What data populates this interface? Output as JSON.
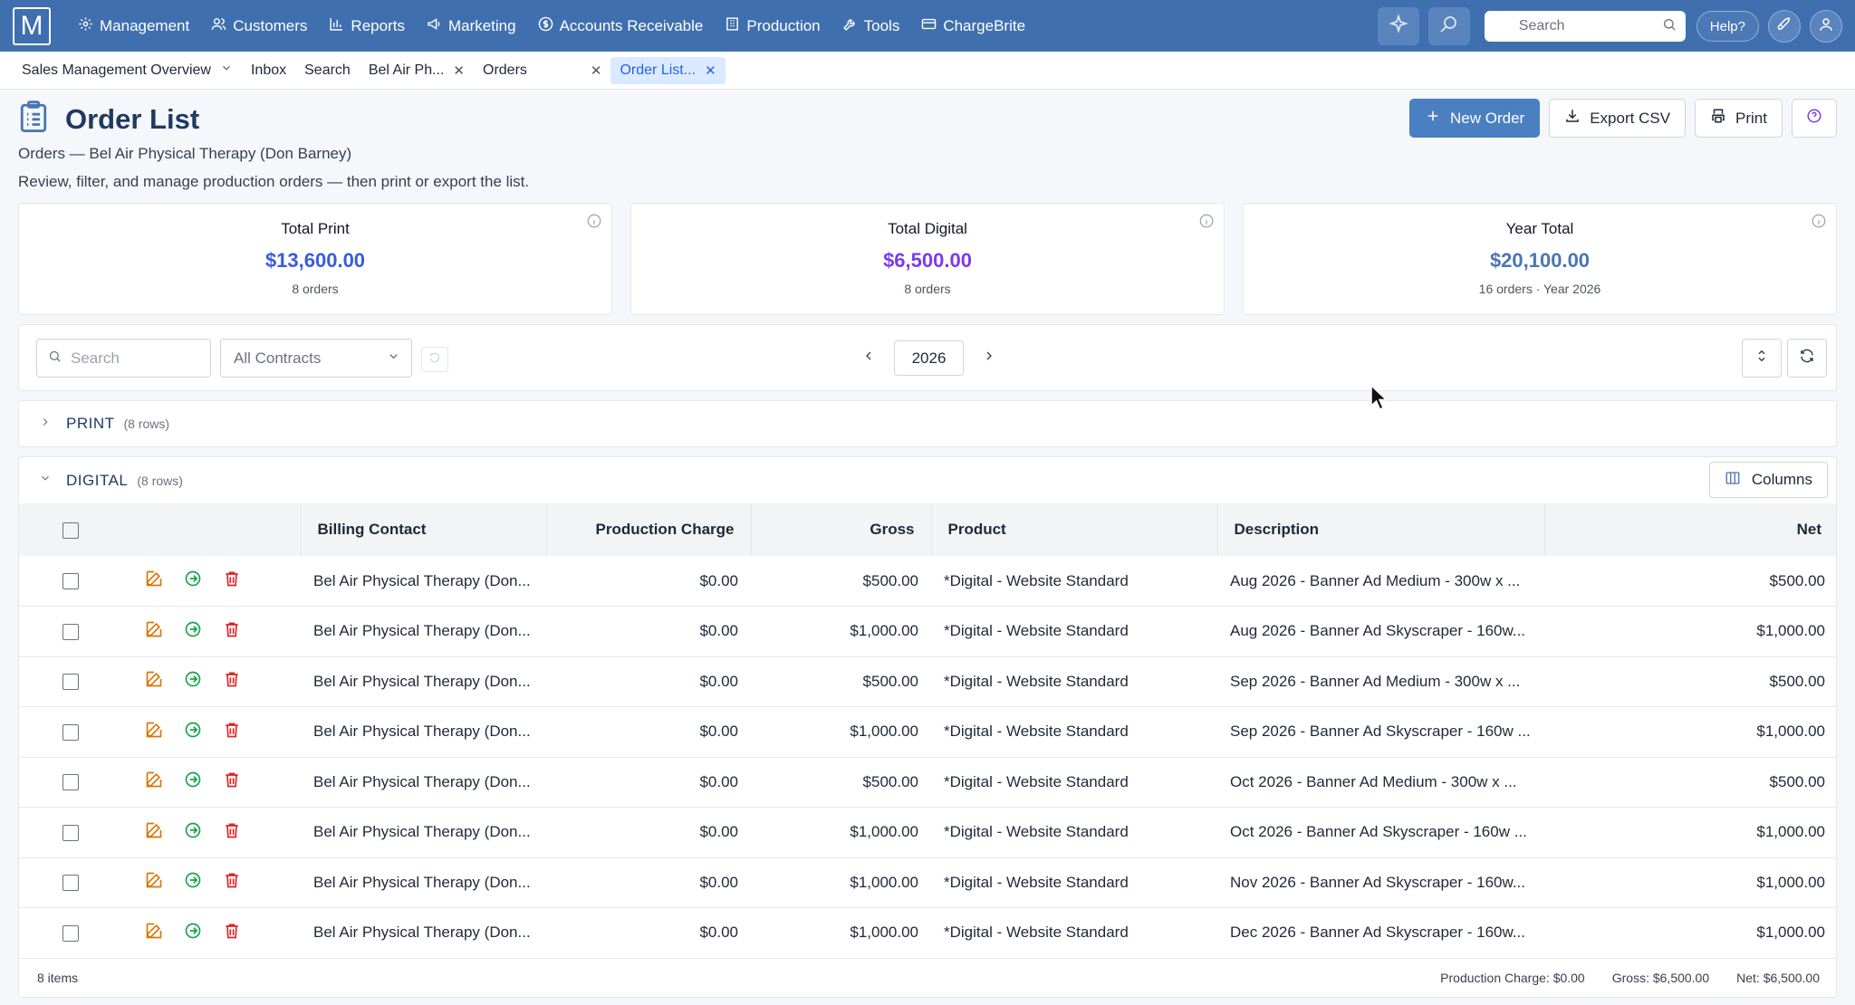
{
  "app": {
    "logo": "M",
    "nav": [
      {
        "label": "Management",
        "icon": "gear-icon"
      },
      {
        "label": "Customers",
        "icon": "users-icon"
      },
      {
        "label": "Reports",
        "icon": "bar-chart-icon"
      },
      {
        "label": "Marketing",
        "icon": "megaphone-icon"
      },
      {
        "label": "Accounts Receivable",
        "icon": "dollar-circle-icon"
      },
      {
        "label": "Production",
        "icon": "building-icon"
      },
      {
        "label": "Tools",
        "icon": "wrench-icon"
      },
      {
        "label": "ChargeBrite",
        "icon": "credit-card-icon"
      }
    ],
    "search_placeholder": "Search",
    "help_label": "Help?"
  },
  "tabs": [
    {
      "label": "Sales Management Overview",
      "has_dropdown": true
    },
    {
      "label": "Inbox"
    },
    {
      "label": "Search"
    },
    {
      "label": "Bel Air Ph...",
      "closable": true
    },
    {
      "label": "Orders",
      "closable": true
    },
    {
      "label": "Order List...",
      "closable": true,
      "active": true
    }
  ],
  "page": {
    "title": "Order List",
    "subtitle": "Orders — Bel Air Physical Therapy (Don Barney)",
    "description": "Review, filter, and manage production orders — then print or export the list.",
    "actions": {
      "new_order": "New Order",
      "export_csv": "Export CSV",
      "print": "Print"
    }
  },
  "cards": [
    {
      "title": "Total Print",
      "value": "$13,600.00",
      "sub": "8 orders",
      "color": "#3b5bdb"
    },
    {
      "title": "Total Digital",
      "value": "$6,500.00",
      "sub": "8 orders",
      "color": "#7c3aed"
    },
    {
      "title": "Year Total",
      "value": "$20,100.00",
      "sub": "16 orders · Year 2026",
      "color": "#4a76b3"
    }
  ],
  "filters": {
    "search_placeholder": "Search",
    "contract": "All Contracts",
    "year": "2026"
  },
  "groups": {
    "print": {
      "label": "PRINT",
      "count": "(8 rows)"
    },
    "digital": {
      "label": "DIGITAL",
      "count": "(8 rows)",
      "columns_label": "Columns"
    }
  },
  "table": {
    "headers": [
      "Billing Contact",
      "Production Charge",
      "Gross",
      "Product",
      "Description",
      "Net"
    ],
    "rows": [
      [
        "Bel Air Physical Therapy (Don...",
        "$0.00",
        "$500.00",
        "*Digital - Website Standard",
        "Aug 2026 - Banner Ad Medium - 300w x ...",
        "$500.00"
      ],
      [
        "Bel Air Physical Therapy (Don...",
        "$0.00",
        "$1,000.00",
        "*Digital - Website Standard",
        "Aug 2026 - Banner Ad Skyscraper - 160w...",
        "$1,000.00"
      ],
      [
        "Bel Air Physical Therapy (Don...",
        "$0.00",
        "$500.00",
        "*Digital - Website Standard",
        "Sep 2026 - Banner Ad Medium - 300w x ...",
        "$500.00"
      ],
      [
        "Bel Air Physical Therapy (Don...",
        "$0.00",
        "$1,000.00",
        "*Digital - Website Standard",
        "Sep 2026 - Banner Ad Skyscraper - 160w ...",
        "$1,000.00"
      ],
      [
        "Bel Air Physical Therapy (Don...",
        "$0.00",
        "$500.00",
        "*Digital - Website Standard",
        "Oct 2026 - Banner Ad Medium - 300w x ...",
        "$500.00"
      ],
      [
        "Bel Air Physical Therapy (Don...",
        "$0.00",
        "$1,000.00",
        "*Digital - Website Standard",
        "Oct 2026 - Banner Ad Skyscraper - 160w ...",
        "$1,000.00"
      ],
      [
        "Bel Air Physical Therapy (Don...",
        "$0.00",
        "$1,000.00",
        "*Digital - Website Standard",
        "Nov 2026 - Banner Ad Skyscraper - 160w...",
        "$1,000.00"
      ],
      [
        "Bel Air Physical Therapy (Don...",
        "$0.00",
        "$1,000.00",
        "*Digital - Website Standard",
        "Dec 2026 - Banner Ad Skyscraper - 160w...",
        "$1,000.00"
      ]
    ]
  },
  "footer": {
    "items": "8 items",
    "production_charge": "Production Charge: $0.00",
    "gross": "Gross: $6,500.00",
    "net": "Net: $6,500.00"
  }
}
